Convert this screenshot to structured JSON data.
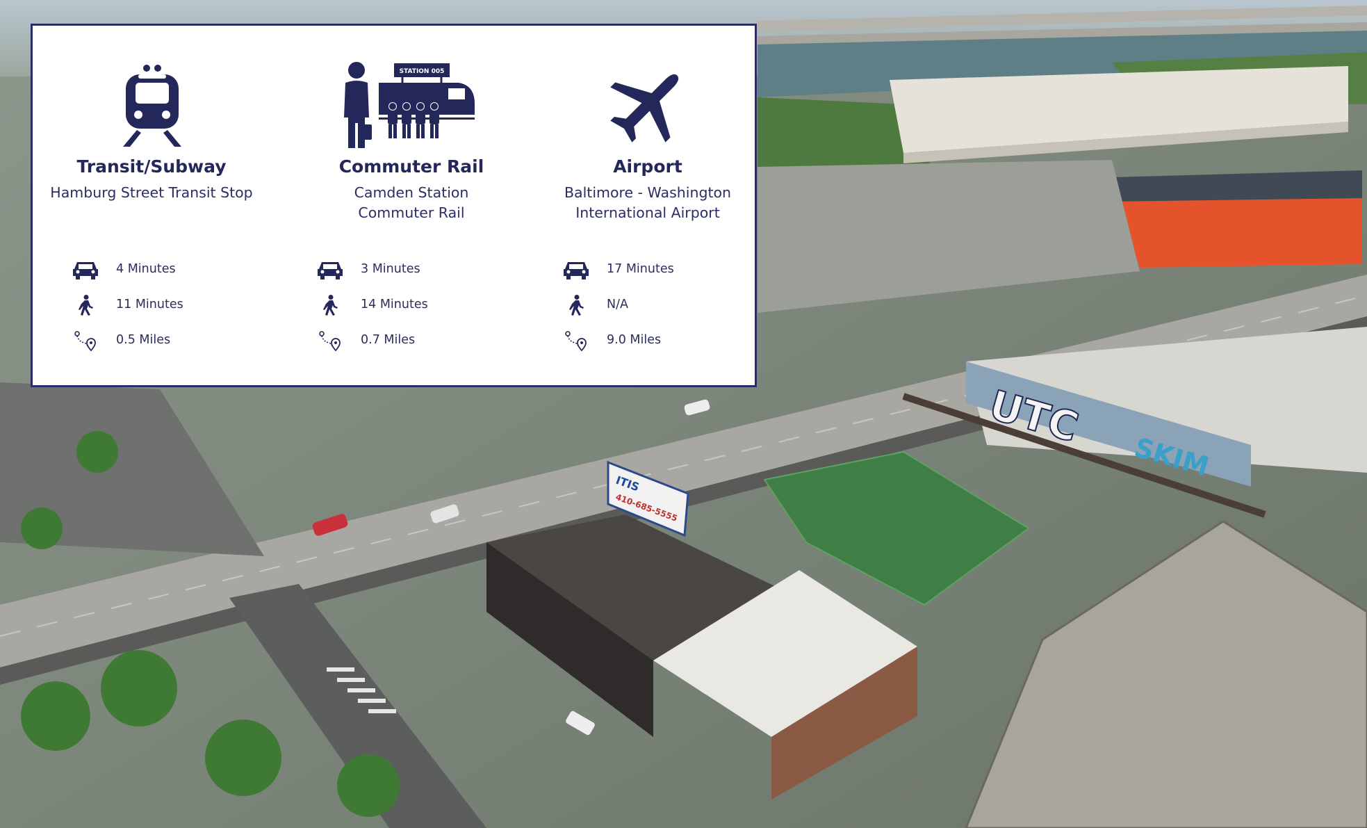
{
  "background": {
    "icon": "aerial-city-photo",
    "colors": {
      "brand": "#24275a",
      "roof_red": "#e5532d",
      "turf": "#3f7f45"
    }
  },
  "columns": [
    {
      "icon": "train-front-icon",
      "title": "Transit/Subway",
      "subtitle": "Hamburg Street Transit Stop",
      "drive": "4 Minutes",
      "walk": "11 Minutes",
      "distance": "0.5 Miles"
    },
    {
      "icon": "commuter-rail-station-icon",
      "station_sign": "STATION 005",
      "title": "Commuter Rail",
      "subtitle": "Camden Station Commuter Rail",
      "drive": "3 Minutes",
      "walk": "14 Minutes",
      "distance": "0.7 Miles"
    },
    {
      "icon": "airplane-icon",
      "title": "Airport",
      "subtitle": "Baltimore - Washington International Airport",
      "drive": "17 Minutes",
      "walk": "N/A",
      "distance": "9.0 Miles"
    }
  ],
  "billboards": {
    "graffiti_main": "UTC",
    "graffiti_side": "SKIM",
    "sign_line1": "ITIS",
    "sign_line2": "410-685-5555"
  }
}
